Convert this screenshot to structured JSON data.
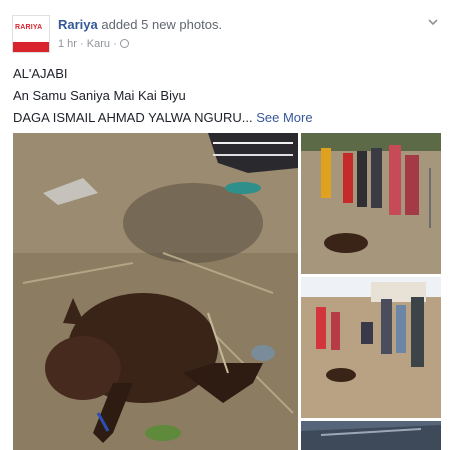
{
  "post": {
    "page_name": "Rariya",
    "action": " added 5 new photos.",
    "time": "1 hr",
    "separator": "·",
    "location": "Karu",
    "separator2": "·",
    "avatar_logo": "RARIYA",
    "lines": [
      "AL'AJABI",
      "An Samu Saniya Mai Kai Biyu",
      "DAGA ISMAIL AHMAD YALWA NGURU..."
    ],
    "see_more": "See More"
  },
  "colors": {
    "link": "#365899",
    "brand_red": "#d9232d",
    "meta_gray": "#90949c"
  },
  "icons": [
    "globe-icon",
    "chevron-down-icon"
  ]
}
